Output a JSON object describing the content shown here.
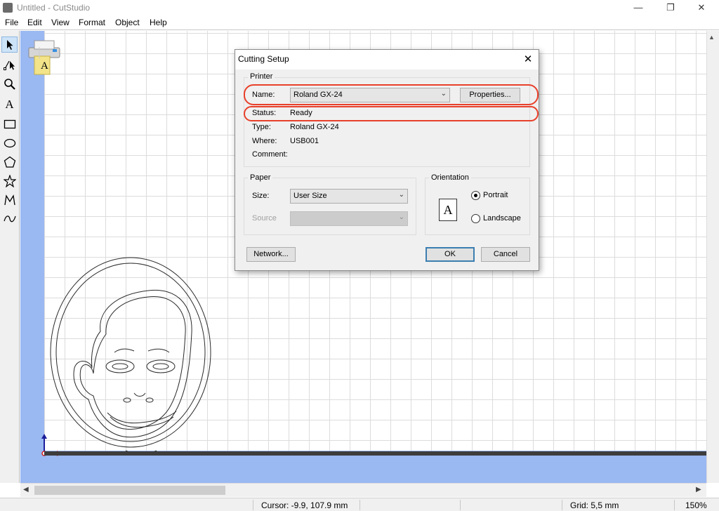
{
  "window": {
    "title": "Untitled - CutStudio",
    "icon": "cutstudio-app-icon",
    "controls": {
      "minimize": "—",
      "maximize": "❐",
      "close": "✕"
    }
  },
  "menubar": {
    "items": [
      {
        "label": "File"
      },
      {
        "label": "Edit"
      },
      {
        "label": "View"
      },
      {
        "label": "Format"
      },
      {
        "label": "Object"
      },
      {
        "label": "Help"
      }
    ]
  },
  "toolbox": {
    "tools": [
      {
        "icon": "select-arrow-icon",
        "active": true
      },
      {
        "icon": "edit-points-icon"
      },
      {
        "icon": "zoom-icon"
      },
      {
        "icon": "text-tool-icon",
        "glyph": "A"
      },
      {
        "icon": "rectangle-icon"
      },
      {
        "icon": "ellipse-icon"
      },
      {
        "icon": "polygon-icon"
      },
      {
        "icon": "star-icon"
      },
      {
        "icon": "polyline-icon"
      },
      {
        "icon": "curve-icon"
      }
    ]
  },
  "canvas": {
    "printer_icon": "cutter-printer-icon",
    "printer_glyph": "A",
    "drawing": "portrait-face-oval-outline",
    "origin_icon": "origin-axes-icon"
  },
  "dialog": {
    "title": "Cutting Setup",
    "close_icon": "close-icon",
    "printer": {
      "group_label": "Printer",
      "name_label": "Name:",
      "name_value": "Roland GX-24",
      "properties_button": "Properties...",
      "status_label": "Status:",
      "status_value": "Ready",
      "type_label": "Type:",
      "type_value": "Roland GX-24",
      "where_label": "Where:",
      "where_value": "USB001",
      "comment_label": "Comment:",
      "comment_value": ""
    },
    "paper": {
      "group_label": "Paper",
      "size_label": "Size:",
      "size_value": "User Size",
      "source_label": "Source",
      "source_value": ""
    },
    "orientation": {
      "group_label": "Orientation",
      "icon": "portrait-page-icon",
      "icon_glyph": "A",
      "portrait_label": "Portrait",
      "landscape_label": "Landscape",
      "selected": "Portrait"
    },
    "buttons": {
      "network": "Network...",
      "ok": "OK",
      "cancel": "Cancel"
    },
    "highlight_color": "#e8402a"
  },
  "statusbar": {
    "cursor": "Cursor: -9.9, 107.9 mm",
    "grid": "Grid: 5,5 mm",
    "zoom": "150%"
  },
  "colors": {
    "workspace": "#9ab8f2",
    "accent": "#3c7fb1"
  }
}
